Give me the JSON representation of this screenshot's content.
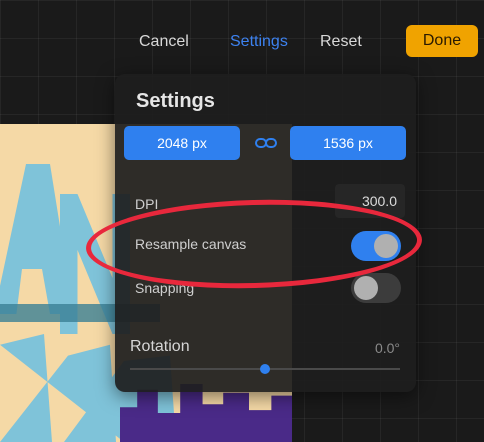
{
  "topbar": {
    "cancel_label": "Cancel",
    "settings_label": "Settings",
    "reset_label": "Reset",
    "done_label": "Done"
  },
  "panel": {
    "title": "Settings",
    "width_value": "2048 px",
    "height_value": "1536 px",
    "dpi_label": "DPI",
    "dpi_value": "300.0",
    "resample_label": "Resample canvas",
    "resample_on": true,
    "snapping_label": "Snapping",
    "snapping_on": false,
    "rotation_label": "Rotation",
    "rotation_value": "0.0°",
    "rotation_slider_fraction": 0.5
  },
  "colors": {
    "accent": "#2f80ef",
    "done": "#f0a300",
    "annotation": "#e8283c"
  }
}
